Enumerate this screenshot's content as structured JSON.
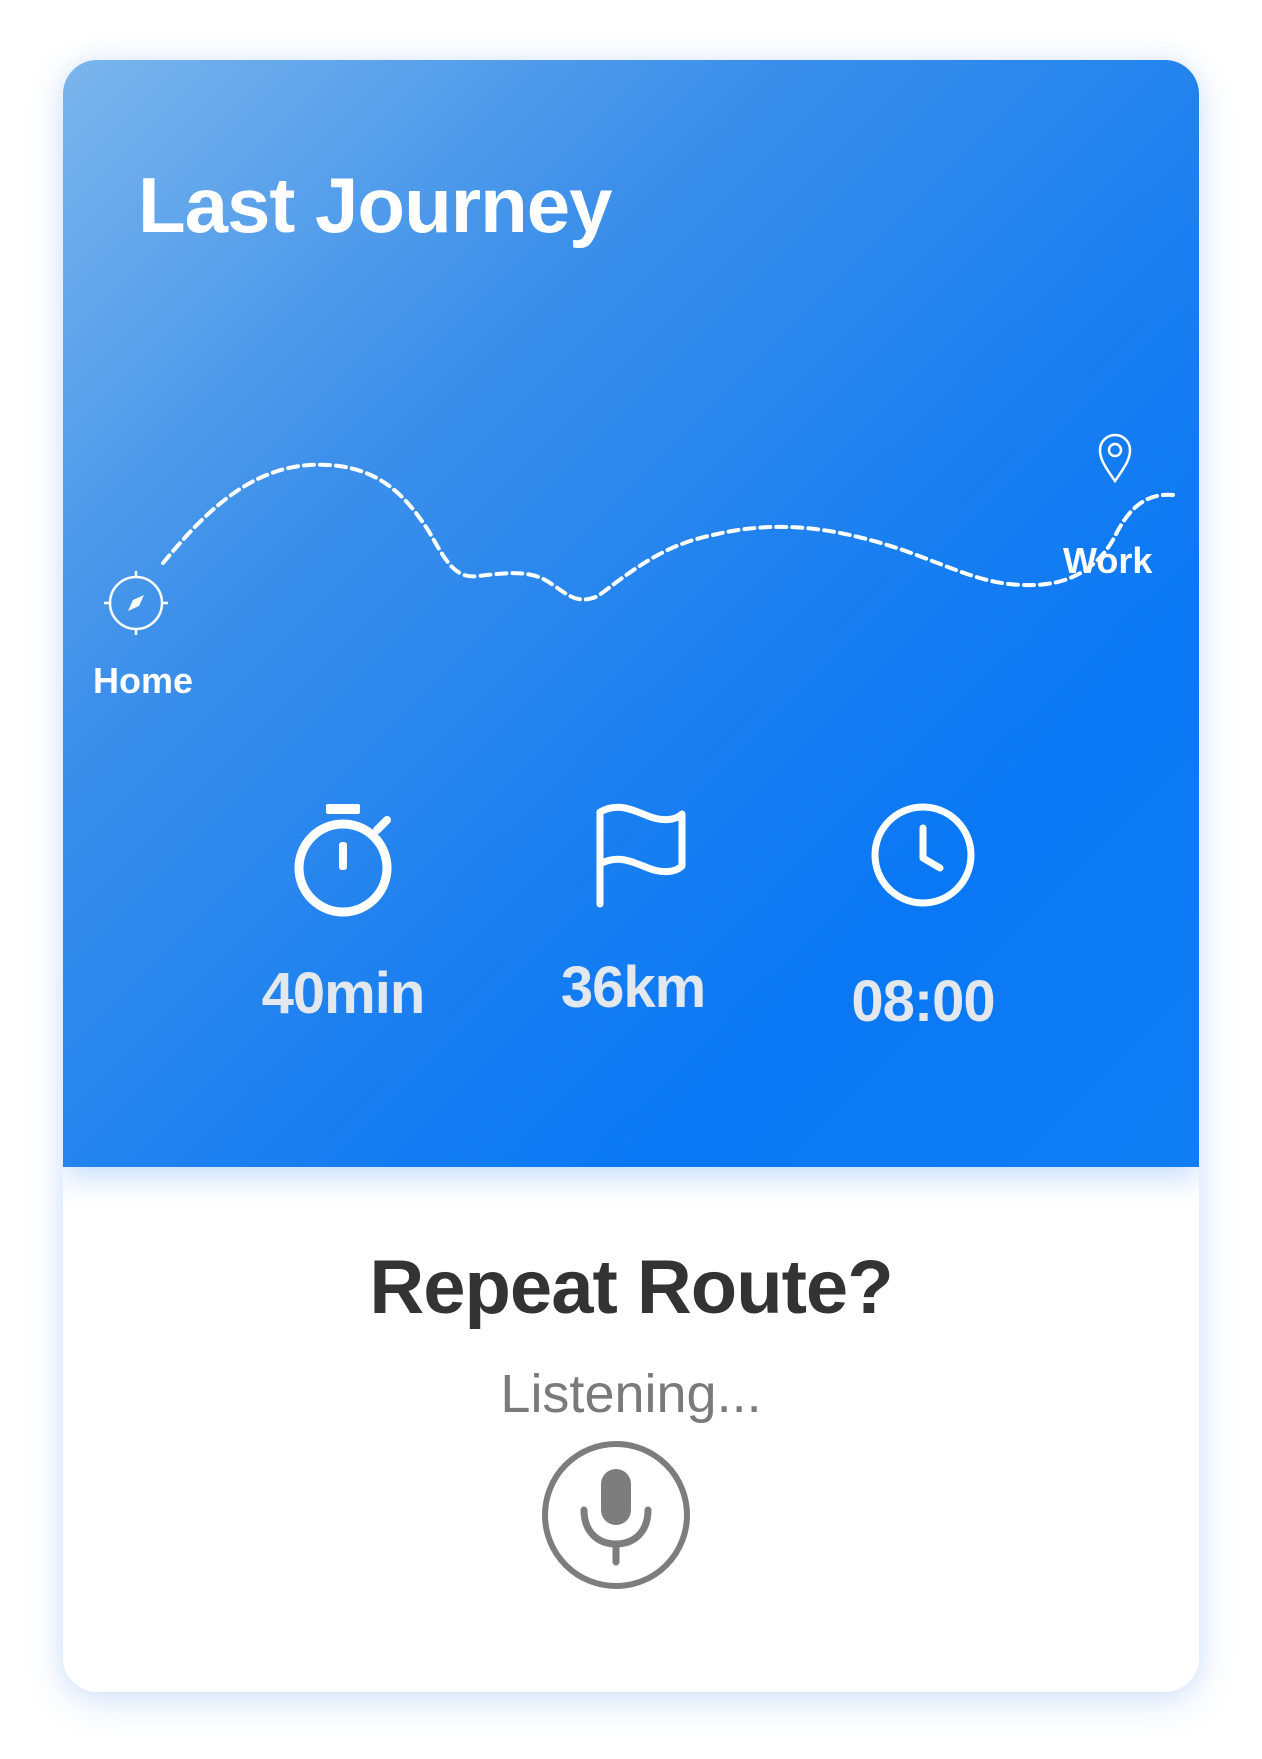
{
  "card": {
    "title": "Last Journey",
    "route": {
      "start_label": "Home",
      "end_label": "Work",
      "start_icon": "compass-icon",
      "end_icon": "location-pin-icon"
    },
    "stats": [
      {
        "icon": "stopwatch-icon",
        "value": "40min"
      },
      {
        "icon": "flag-icon",
        "value": "36km"
      },
      {
        "icon": "clock-icon",
        "value": "08:00"
      }
    ]
  },
  "prompt": {
    "question": "Repeat Route?",
    "status": "Listening...",
    "mic_icon": "microphone-icon"
  },
  "colors": {
    "hero_gradient_start": "#7bb5ec",
    "hero_gradient_end": "#0a78f5",
    "stat_value": "#e3e8ef",
    "question_text": "#333333",
    "status_text": "#7a7a7a",
    "mic": "#7d7d7d"
  }
}
